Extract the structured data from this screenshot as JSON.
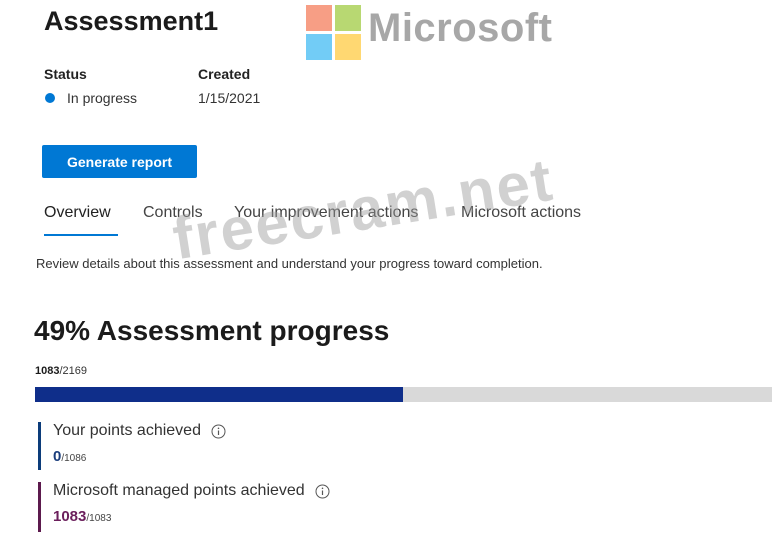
{
  "header": {
    "title": "Assessment1",
    "brand": "Microsoft",
    "brand_colors": [
      "#f25022",
      "#7fba00",
      "#00a4ef",
      "#ffb900"
    ]
  },
  "meta": {
    "status_label": "Status",
    "status_value": "In progress",
    "status_color": "#0078d4",
    "created_label": "Created",
    "created_value": "1/15/2021"
  },
  "actions": {
    "generate_report": "Generate report"
  },
  "tabs": [
    {
      "label": "Overview",
      "active": true
    },
    {
      "label": "Controls",
      "active": false
    },
    {
      "label": "Your improvement actions",
      "active": false
    },
    {
      "label": "Microsoft actions",
      "active": false
    }
  ],
  "description": "Review details about this assessment and understand your progress toward completion.",
  "watermark": "freecram.net",
  "progress": {
    "title": "49% Assessment progress",
    "achieved": "1083",
    "total": "/2169",
    "fraction": 0.499,
    "fill_color": "#0f2e8a"
  },
  "points": {
    "yours": {
      "label": "Your points achieved",
      "value": "0",
      "denom": "/1086",
      "accent": "#0c3c7a"
    },
    "microsoft": {
      "label": "Microsoft managed points achieved",
      "value": "1083",
      "denom": "/1083",
      "accent": "#5c1a4d"
    }
  }
}
